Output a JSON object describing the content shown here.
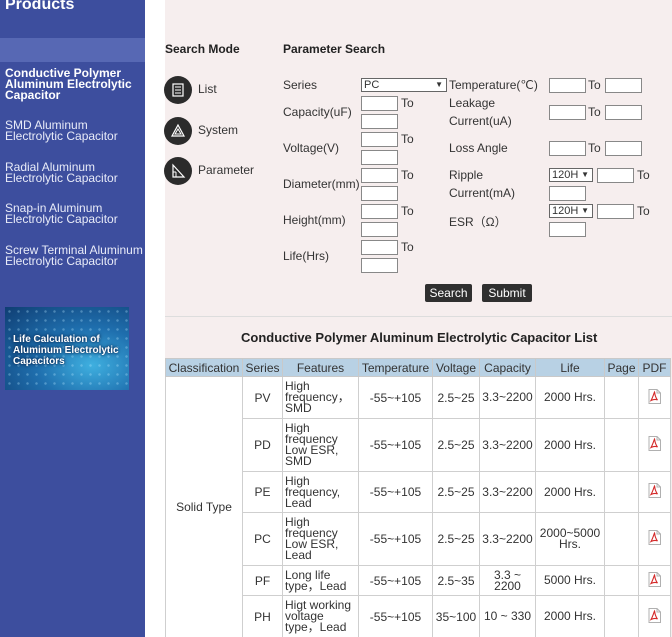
{
  "sidebar": {
    "title": "Products",
    "categories": [
      "Conductive Polymer Aluminum Electrolytic Capacitor",
      "SMD Aluminum Electrolytic Capacitor",
      "Radial Aluminum Electrolytic Capacitor",
      "Snap-in Aluminum Electrolytic Capacitor",
      "Screw Terminal Aluminum Electrolytic Capacitor"
    ],
    "banner": "Life Calculation of Aluminum Electrolytic Capacitors"
  },
  "search": {
    "mode_header": "Search Mode",
    "param_header": "Parameter Search",
    "modes": [
      "List",
      "System",
      "Parameter"
    ],
    "to": "To",
    "series_label": "Series",
    "series_value": "PC",
    "capacity_label": "Capacity(uF)",
    "voltage_label": "Voltage(V)",
    "diameter_label": "Diameter(mm)",
    "height_label": "Height(mm)",
    "life_label": "Life(Hrs)",
    "temperature_label": "Temperature(℃)",
    "leakage_label_1": "Leakage",
    "leakage_label_2": "Current(uA)",
    "loss_angle_label": "Loss Angle",
    "ripple_label_1": "Ripple",
    "ripple_label_2": "Current(mA)",
    "ripple_freq": "120H",
    "esr_label": "ESR（Ω）",
    "esr_freq": "120H",
    "search_button": "Search",
    "submit_button": "Submit"
  },
  "list": {
    "title": "Conductive Polymer Aluminum Electrolytic Capacitor List",
    "headers": [
      "Classification",
      "Series",
      "Features",
      "Temperature",
      "Voltage",
      "Capacity",
      "Life",
      "Page",
      "PDF"
    ],
    "classification": "Solid Type",
    "rows": [
      {
        "series": "PV",
        "features": [
          "High",
          "frequency，",
          "SMD"
        ],
        "temperature": "-55~+105",
        "voltage": "2.5~25",
        "capacity": [
          "3.3~2200"
        ],
        "life": [
          "2000 Hrs."
        ]
      },
      {
        "series": "PD",
        "features": [
          "High",
          "frequency",
          "Low ESR,",
          "SMD"
        ],
        "temperature": "-55~+105",
        "voltage": "2.5~25",
        "capacity": [
          "3.3~2200"
        ],
        "life": [
          "2000 Hrs."
        ]
      },
      {
        "series": "PE",
        "features": [
          "High",
          "frequency,",
          "Lead"
        ],
        "temperature": "-55~+105",
        "voltage": "2.5~25",
        "capacity": [
          "3.3~2200"
        ],
        "life": [
          "2000 Hrs."
        ]
      },
      {
        "series": "PC",
        "features": [
          "High",
          "frequency",
          "Low ESR,",
          "Lead"
        ],
        "temperature": "-55~+105",
        "voltage": "2.5~25",
        "capacity": [
          "3.3~2200"
        ],
        "life": [
          "2000~5000",
          "Hrs."
        ]
      },
      {
        "series": "PF",
        "features": [
          "Long life",
          "type，Lead"
        ],
        "temperature": "-55~+105",
        "voltage": "2.5~35",
        "capacity": [
          "3.3 ~",
          "2200"
        ],
        "life": [
          "5000 Hrs."
        ]
      },
      {
        "series": "PH",
        "features": [
          "Higt working",
          "voltage",
          "type，Lead"
        ],
        "temperature": "-55~+105",
        "voltage": "35~100",
        "capacity": [
          "10 ~ 330"
        ],
        "life": [
          "2000 Hrs."
        ]
      }
    ]
  },
  "colors": {
    "sidebar_bg": "#3d4e9e",
    "table_header_bg": "#b8d1e4",
    "pdf_red": "#d42a2a"
  }
}
